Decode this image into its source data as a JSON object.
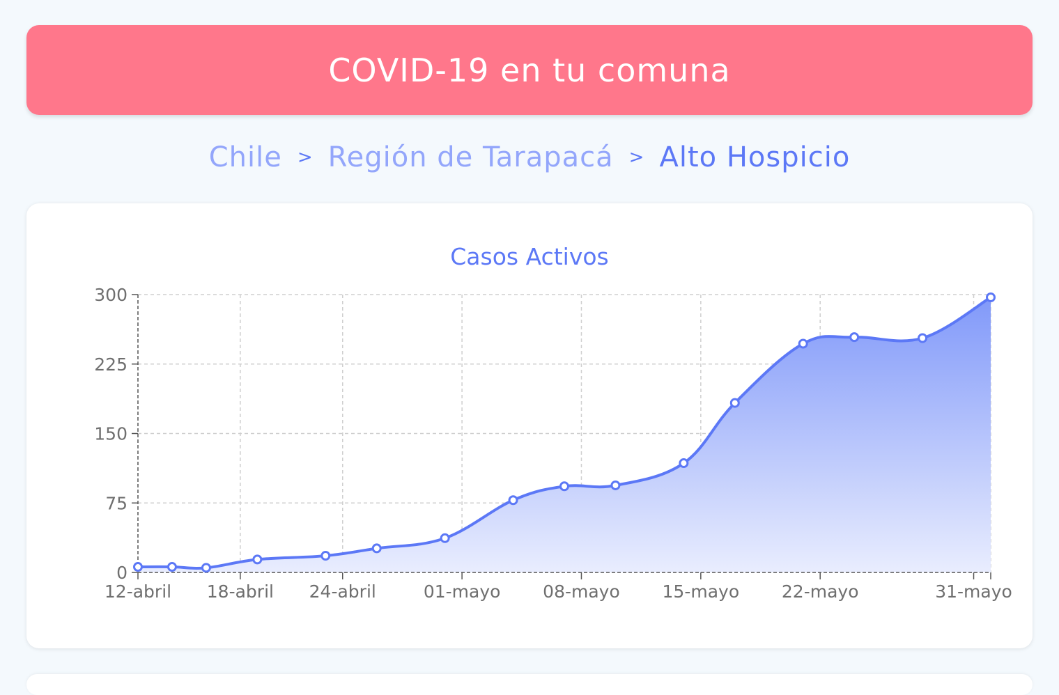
{
  "header": {
    "title": "COVID-19 en tu comuna"
  },
  "breadcrumb": {
    "items": [
      "Chile",
      "Región de Tarapacá",
      "Alto Hospicio"
    ],
    "separator": ">"
  },
  "colors": {
    "header_bg": "#ff778b",
    "accent": "#5c78f6",
    "breadcrumb_link": "#93a6fb"
  },
  "chart_data": {
    "type": "area",
    "title": "Casos Activos",
    "xlabel": "",
    "ylabel": "",
    "ylim": [
      0,
      300
    ],
    "yticks": [
      0,
      75,
      150,
      225,
      300
    ],
    "xlim": [
      "2020-04-12",
      "2020-06-01"
    ],
    "xticks": [
      {
        "date": "2020-04-12",
        "label": "12-abril"
      },
      {
        "date": "2020-04-18",
        "label": "18-abril"
      },
      {
        "date": "2020-04-24",
        "label": "24-abril"
      },
      {
        "date": "2020-05-01",
        "label": "01-mayo"
      },
      {
        "date": "2020-05-08",
        "label": "08-mayo"
      },
      {
        "date": "2020-05-15",
        "label": "15-mayo"
      },
      {
        "date": "2020-05-22",
        "label": "22-mayo"
      },
      {
        "date": "2020-05-31",
        "label": "31-mayo"
      }
    ],
    "grid": true,
    "series": [
      {
        "x": [
          "2020-04-12",
          "2020-04-14",
          "2020-04-16",
          "2020-04-19",
          "2020-04-23",
          "2020-04-26",
          "2020-04-30",
          "2020-05-04",
          "2020-05-07",
          "2020-05-10",
          "2020-05-14",
          "2020-05-17",
          "2020-05-21",
          "2020-05-24",
          "2020-05-28",
          "2020-06-01"
        ],
        "values": [
          6,
          6,
          5,
          14,
          18,
          26,
          37,
          78,
          93,
          94,
          118,
          183,
          247,
          254,
          253,
          297
        ]
      }
    ]
  }
}
